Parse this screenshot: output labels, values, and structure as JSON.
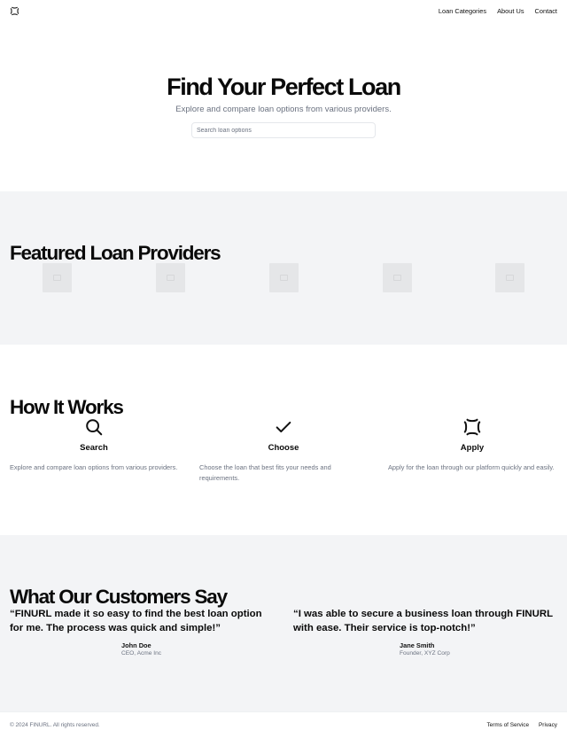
{
  "header": {
    "logo_icon": "shield-logo-icon",
    "nav": [
      "Loan Categories",
      "About Us",
      "Contact"
    ]
  },
  "hero": {
    "title": "Find Your Perfect Loan",
    "subtitle": "Explore and compare loan options from various providers.",
    "search_placeholder": "Search loan options"
  },
  "featured": {
    "title": "Featured Loan Providers",
    "provider_icon": "image-placeholder-icon",
    "provider_count": 5
  },
  "how": {
    "title": "How It Works",
    "steps": [
      {
        "icon": "search-icon",
        "title": "Search",
        "desc": "Explore and compare loan options from various providers."
      },
      {
        "icon": "check-icon",
        "title": "Choose",
        "desc": "Choose the loan that best fits your needs and requirements."
      },
      {
        "icon": "shield-icon",
        "title": "Apply",
        "desc": "Apply for the loan through our platform quickly and easily."
      }
    ]
  },
  "testimonials": {
    "title": "What Our Customers Say",
    "items": [
      {
        "quote": "“FINURL made it so easy to find the best loan option for me. The process was quick and simple!”",
        "name": "John Doe",
        "role": "CEO, Acme Inc"
      },
      {
        "quote": "“I was able to secure a business loan through FINURL with ease. Their service is top-notch!”",
        "name": "Jane Smith",
        "role": "Founder, XYZ Corp"
      }
    ]
  },
  "footer": {
    "copyright": "© 2024 FINURL. All rights reserved.",
    "links": [
      "Terms of Service",
      "Privacy"
    ]
  },
  "colors": {
    "section_gray": "#f3f4f6",
    "muted_text": "#6b7280",
    "heading": "#0a0a0a"
  }
}
